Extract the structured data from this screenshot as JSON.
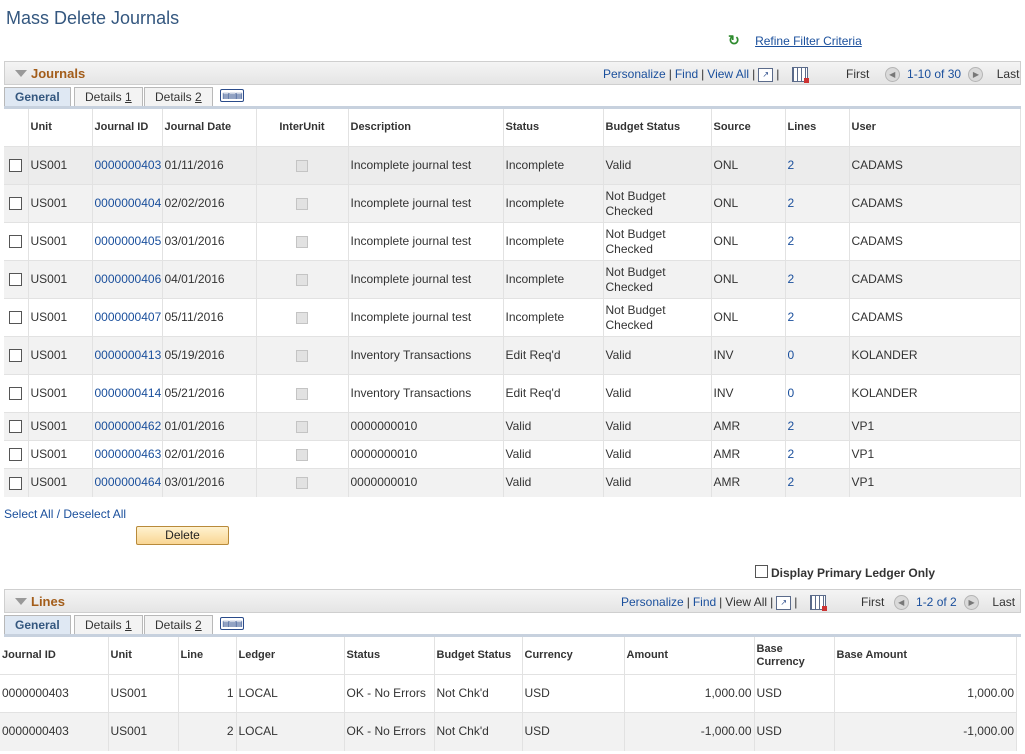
{
  "page": {
    "title": "Mass Delete Journals",
    "refine_label": "Refine Filter Criteria",
    "select_all_label": "Select All / Deselect All",
    "delete_label": "Delete",
    "display_primary_label": "Display Primary Ledger Only"
  },
  "journals": {
    "title": "Journals",
    "personalize": "Personalize",
    "find": "Find",
    "view_all": "View All",
    "first": "First",
    "range": "1-10 of 30",
    "last": "Last",
    "tabs": [
      "General",
      "Details ",
      "Details "
    ],
    "tab_keys": [
      "",
      "1",
      "2"
    ],
    "columns": [
      "Unit",
      "Journal ID",
      "Journal Date",
      "InterUnit",
      "Description",
      "Status",
      "Budget Status",
      "Source",
      "Lines",
      "User"
    ],
    "rows": [
      {
        "unit": "US001",
        "id": "0000000403",
        "date": "01/11/2016",
        "desc": "Incomplete journal test",
        "status": "Incomplete",
        "budget": "Valid",
        "source": "ONL",
        "lines": "2",
        "user": "CADAMS"
      },
      {
        "unit": "US001",
        "id": "0000000404",
        "date": "02/02/2016",
        "desc": "Incomplete journal test",
        "status": "Incomplete",
        "budget": "Not Budget Checked",
        "source": "ONL",
        "lines": "2",
        "user": "CADAMS"
      },
      {
        "unit": "US001",
        "id": "0000000405",
        "date": "03/01/2016",
        "desc": "Incomplete journal test",
        "status": "Incomplete",
        "budget": "Not Budget Checked",
        "source": "ONL",
        "lines": "2",
        "user": "CADAMS"
      },
      {
        "unit": "US001",
        "id": "0000000406",
        "date": "04/01/2016",
        "desc": "Incomplete journal test",
        "status": "Incomplete",
        "budget": "Not Budget Checked",
        "source": "ONL",
        "lines": "2",
        "user": "CADAMS"
      },
      {
        "unit": "US001",
        "id": "0000000407",
        "date": "05/11/2016",
        "desc": "Incomplete journal test",
        "status": "Incomplete",
        "budget": "Not Budget Checked",
        "source": "ONL",
        "lines": "2",
        "user": "CADAMS"
      },
      {
        "unit": "US001",
        "id": "0000000413",
        "date": "05/19/2016",
        "desc": "Inventory Transactions",
        "status": "Edit Req'd",
        "budget": "Valid",
        "source": "INV",
        "lines": "0",
        "user": "KOLANDER"
      },
      {
        "unit": "US001",
        "id": "0000000414",
        "date": "05/21/2016",
        "desc": "Inventory Transactions",
        "status": "Edit Req'd",
        "budget": "Valid",
        "source": "INV",
        "lines": "0",
        "user": "KOLANDER"
      },
      {
        "unit": "US001",
        "id": "0000000462",
        "date": "01/01/2016",
        "desc": "0000000010",
        "status": "Valid",
        "budget": "Valid",
        "source": "AMR",
        "lines": "2",
        "user": "VP1"
      },
      {
        "unit": "US001",
        "id": "0000000463",
        "date": "02/01/2016",
        "desc": "0000000010",
        "status": "Valid",
        "budget": "Valid",
        "source": "AMR",
        "lines": "2",
        "user": "VP1"
      },
      {
        "unit": "US001",
        "id": "0000000464",
        "date": "03/01/2016",
        "desc": "0000000010",
        "status": "Valid",
        "budget": "Valid",
        "source": "AMR",
        "lines": "2",
        "user": "VP1"
      }
    ]
  },
  "lines": {
    "title": "Lines",
    "personalize": "Personalize",
    "find": "Find",
    "view_all": "View All",
    "first": "First",
    "range": "1-2 of 2",
    "last": "Last",
    "tabs": [
      "General",
      "Details ",
      "Details "
    ],
    "tab_keys": [
      "",
      "1",
      "2"
    ],
    "columns": [
      "Journal ID",
      "Unit",
      "Line",
      "Ledger",
      "Status",
      "Budget Status",
      "Currency",
      "Amount",
      "Base Currency",
      "Base Amount"
    ],
    "rows": [
      {
        "id": "0000000403",
        "unit": "US001",
        "line": "1",
        "ledger": "LOCAL",
        "status": "OK - No Errors",
        "budget": "Not Chk'd",
        "currency": "USD",
        "amount": "1,000.00",
        "base_currency": "USD",
        "base_amount": "1,000.00"
      },
      {
        "id": "0000000403",
        "unit": "US001",
        "line": "2",
        "ledger": "LOCAL",
        "status": "OK - No Errors",
        "budget": "Not Chk'd",
        "currency": "USD",
        "amount": "-1,000.00",
        "base_currency": "USD",
        "base_amount": "-1,000.00"
      }
    ]
  }
}
